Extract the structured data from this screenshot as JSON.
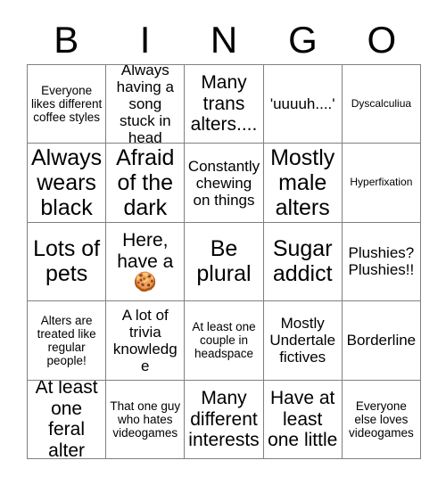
{
  "card": {
    "header_letters": [
      "B",
      "I",
      "N",
      "G",
      "O"
    ],
    "rows": [
      [
        {
          "text": "Everyone likes different coffee styles",
          "size": "fs-sm"
        },
        {
          "text": "Always having a song stuck in head",
          "size": "fs-md"
        },
        {
          "text": "Many trans alters....",
          "size": "fs-lg"
        },
        {
          "text": "'uuuuh....'",
          "size": "fs-md"
        },
        {
          "text": "Dyscalculiua",
          "size": "fs-xs"
        }
      ],
      [
        {
          "text": "Always wears black",
          "size": "fs-xl"
        },
        {
          "text": "Afraid of the dark",
          "size": "fs-xl"
        },
        {
          "text": "Constantly chewing on things",
          "size": "fs-md"
        },
        {
          "text": "Mostly male alters",
          "size": "fs-xl"
        },
        {
          "text": "Hyperfixation",
          "size": "fs-xs"
        }
      ],
      [
        {
          "text": "Lots of pets",
          "size": "fs-xl"
        },
        {
          "text": "Here, have a 🍪",
          "size": "fs-lg"
        },
        {
          "text": "Be plural",
          "size": "fs-xl"
        },
        {
          "text": "Sugar addict",
          "size": "fs-xl"
        },
        {
          "text": "Plushies? Plushies!!",
          "size": "fs-md"
        }
      ],
      [
        {
          "text": "Alters are treated like regular people!",
          "size": "fs-sm"
        },
        {
          "text": "A lot of trivia knowledge",
          "size": "fs-md"
        },
        {
          "text": "At least one couple in headspace",
          "size": "fs-sm"
        },
        {
          "text": "Mostly Undertale fictives",
          "size": "fs-md"
        },
        {
          "text": "Borderline",
          "size": "fs-md"
        }
      ],
      [
        {
          "text": "At least one feral alter",
          "size": "fs-lg"
        },
        {
          "text": "That one guy who hates videogames",
          "size": "fs-sm"
        },
        {
          "text": "Many different interests",
          "size": "fs-lg"
        },
        {
          "text": "Have at least one little",
          "size": "fs-lg"
        },
        {
          "text": "Everyone else loves videogames",
          "size": "fs-sm"
        }
      ]
    ]
  },
  "colors": {
    "background": "#ffffff",
    "text": "#000000",
    "grid_line": "#808080"
  }
}
